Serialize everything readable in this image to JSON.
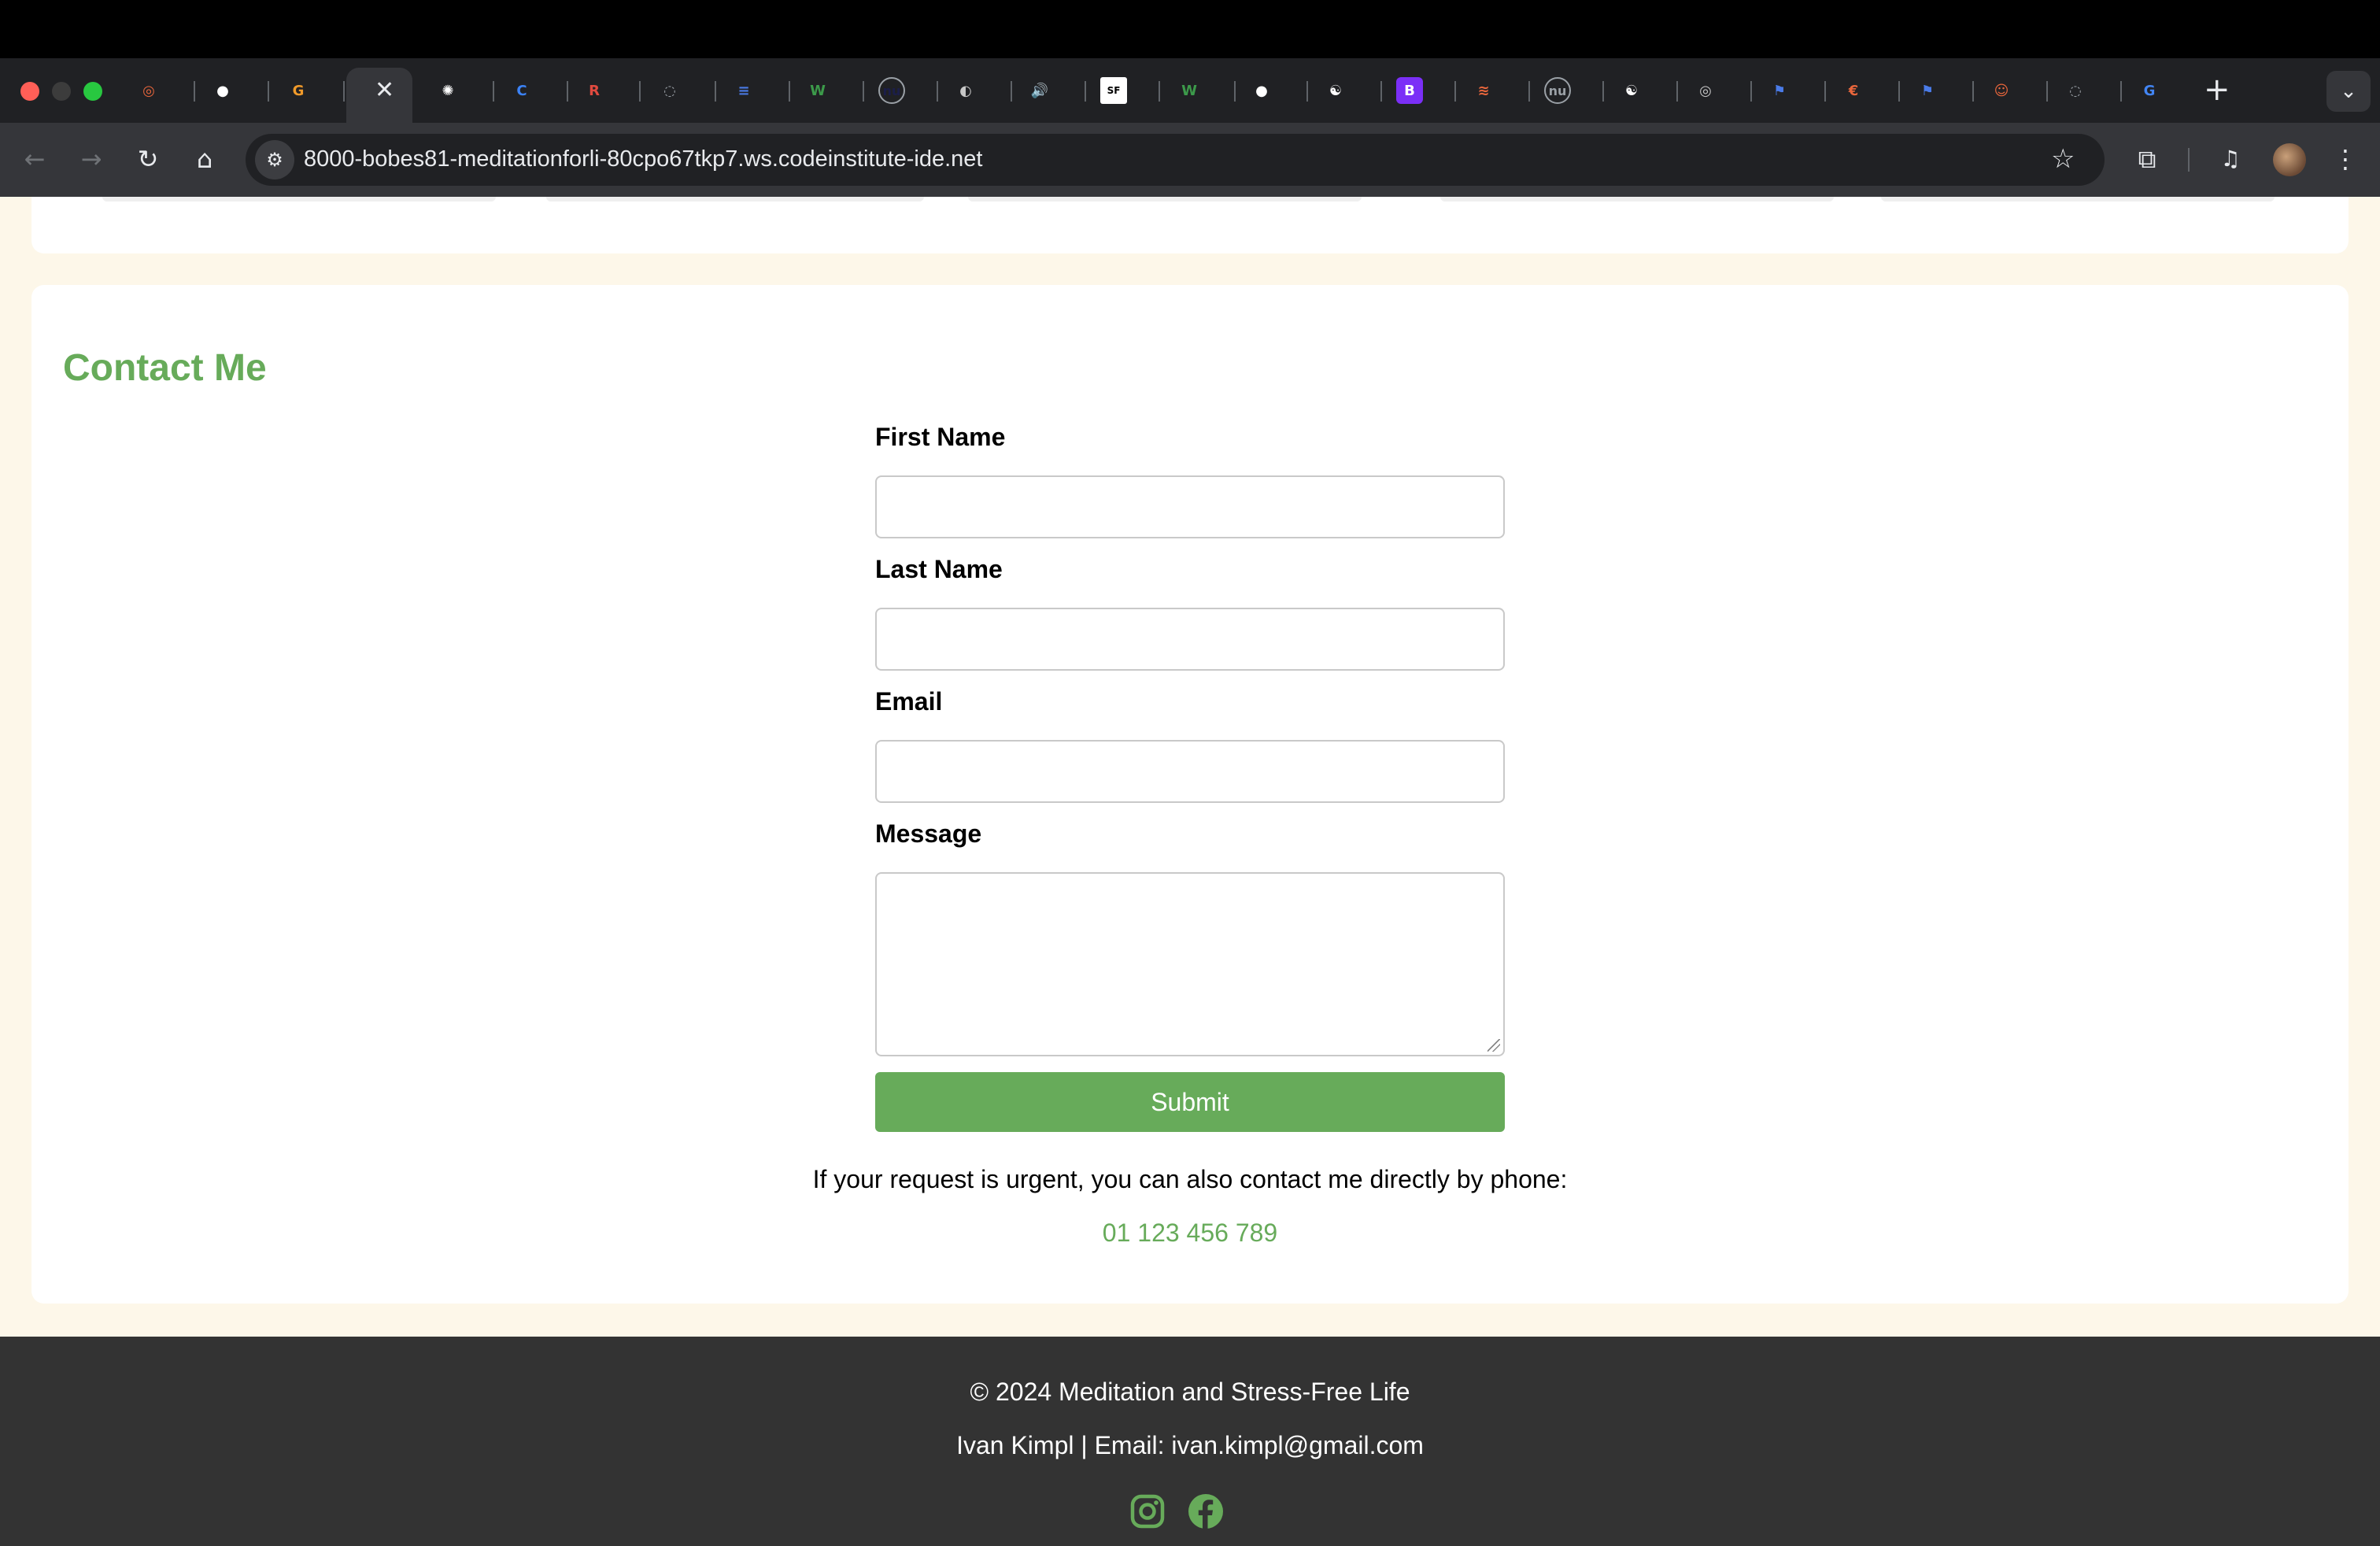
{
  "browser": {
    "url": "8000-bobes81-meditationforli-80cpo67tkp7.ws.codeinstitute-ide.net",
    "tab_close": "✕",
    "new_tab": "+",
    "tab_menu": "⌄",
    "tab_favicons": [
      {
        "icon": "target-icon",
        "glyph": "◎",
        "color": "#e8663c"
      },
      {
        "icon": "github-icon",
        "glyph": "●",
        "color": "#ffffff"
      },
      {
        "icon": "g-logo-icon",
        "glyph": "G",
        "color": "#f09a2a"
      },
      {
        "icon": "openai-icon",
        "glyph": "✺",
        "color": "#ffffff"
      },
      {
        "icon": "canva-icon",
        "glyph": "C",
        "color": "#3b82f6"
      },
      {
        "icon": "r-logo-icon",
        "glyph": "R",
        "color": "#e04a3f"
      },
      {
        "icon": "spinner-icon",
        "glyph": "◌",
        "color": "#9aa0a6"
      },
      {
        "icon": "list-icon",
        "glyph": "≡",
        "color": "#4a7be8"
      },
      {
        "icon": "w-logo-icon",
        "glyph": "W",
        "color": "#3c9a4a"
      },
      {
        "icon": "nu-icon",
        "glyph": "nu",
        "color": "#1b1e4a"
      },
      {
        "icon": "globe-icon",
        "glyph": "◐",
        "color": "#c7c7c7"
      },
      {
        "icon": "speaker-icon",
        "glyph": "🔊",
        "color": "#e8eaed"
      },
      {
        "icon": "sfi-icon",
        "glyph": "SF",
        "color": "#ffffff"
      },
      {
        "icon": "w-logo-icon",
        "glyph": "W",
        "color": "#3c9a4a"
      },
      {
        "icon": "github-icon",
        "glyph": "●",
        "color": "#ffffff"
      },
      {
        "icon": "avatar-icon",
        "glyph": "☯",
        "color": "#ffffff"
      },
      {
        "icon": "bootstrap-icon",
        "glyph": "B",
        "color": "#7b2ff7"
      },
      {
        "icon": "stack-icon",
        "glyph": "≋",
        "color": "#e8663c"
      },
      {
        "icon": "nu-icon",
        "glyph": "nu",
        "color": "#9aa0a6"
      },
      {
        "icon": "avatar-icon",
        "glyph": "☯",
        "color": "#ffffff"
      },
      {
        "icon": "chrome-icon",
        "glyph": "◎",
        "color": "#c7c7c7"
      },
      {
        "icon": "flag-icon",
        "glyph": "⚑",
        "color": "#4a7be8"
      },
      {
        "icon": "code-icon",
        "glyph": "€",
        "color": "#e8663c"
      },
      {
        "icon": "flag-icon",
        "glyph": "⚑",
        "color": "#4a7be8"
      },
      {
        "icon": "face-icon",
        "glyph": "☺",
        "color": "#e8663c"
      },
      {
        "icon": "spinner-icon",
        "glyph": "◌",
        "color": "#9aa0a6"
      },
      {
        "icon": "google-icon",
        "glyph": "G",
        "color": "#4285f4"
      }
    ]
  },
  "contact": {
    "title": "Contact Me",
    "first_name_label": "First Name",
    "first_name_value": "",
    "last_name_label": "Last Name",
    "last_name_value": "",
    "email_label": "Email",
    "email_value": "",
    "message_label": "Message",
    "message_value": "",
    "submit_label": "Submit",
    "urgent_note": "If your request is urgent, you can also contact me directly by phone:",
    "phone": "01 123 456 789"
  },
  "footer": {
    "copyright": "© 2024 Meditation and Stress-Free Life",
    "author_line": "Ivan Kimpl | Email: ivan.kimpl@gmail.com",
    "social": [
      "instagram-icon",
      "facebook-icon"
    ]
  },
  "colors": {
    "accent": "#67ab5a",
    "page_bg": "#fdf7e9",
    "footer_bg": "#333333"
  }
}
